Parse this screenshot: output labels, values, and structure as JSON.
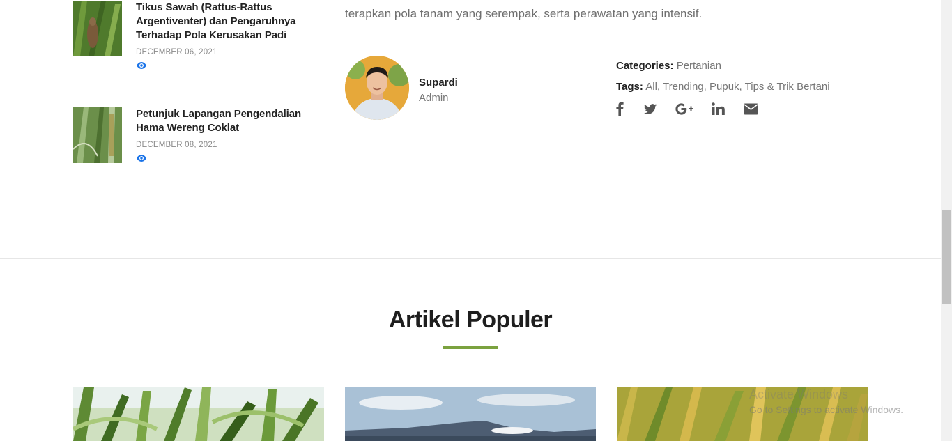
{
  "recent_posts": [
    {
      "title": "Tikus Sawah (Rattus-Rattus Argentiventer) dan Pengaruhnya Terhadap Pola Kerusakan Padi",
      "date": "DECEMBER 06, 2021",
      "icon": "eye-icon"
    },
    {
      "title": "Petunjuk Lapangan Pengendalian Hama Wereng Coklat",
      "date": "DECEMBER 08, 2021",
      "icon": "eye-icon"
    }
  ],
  "article": {
    "closing_text": "terapkan pola tanam yang serempak, serta perawatan yang intensif."
  },
  "author": {
    "name": "Supardi",
    "role": "Admin"
  },
  "meta": {
    "categories_label": "Categories:",
    "categories_value": "Pertanian",
    "tags_label": "Tags:",
    "tags": [
      "All",
      "Trending",
      "Pupuk",
      "Tips & Trik Bertani"
    ]
  },
  "share_icons": [
    "facebook-icon",
    "twitter-icon",
    "google-plus-icon",
    "linkedin-icon",
    "envelope-icon"
  ],
  "popular": {
    "title": "Artikel Populer"
  },
  "watermark": {
    "line1": "Activate Windows",
    "line2": "Go to Settings to activate Windows."
  },
  "colors": {
    "accent": "#7ba23f",
    "eye_icon": "#1a73e8",
    "heading": "#1e1e1e",
    "muted_text": "#777777"
  }
}
